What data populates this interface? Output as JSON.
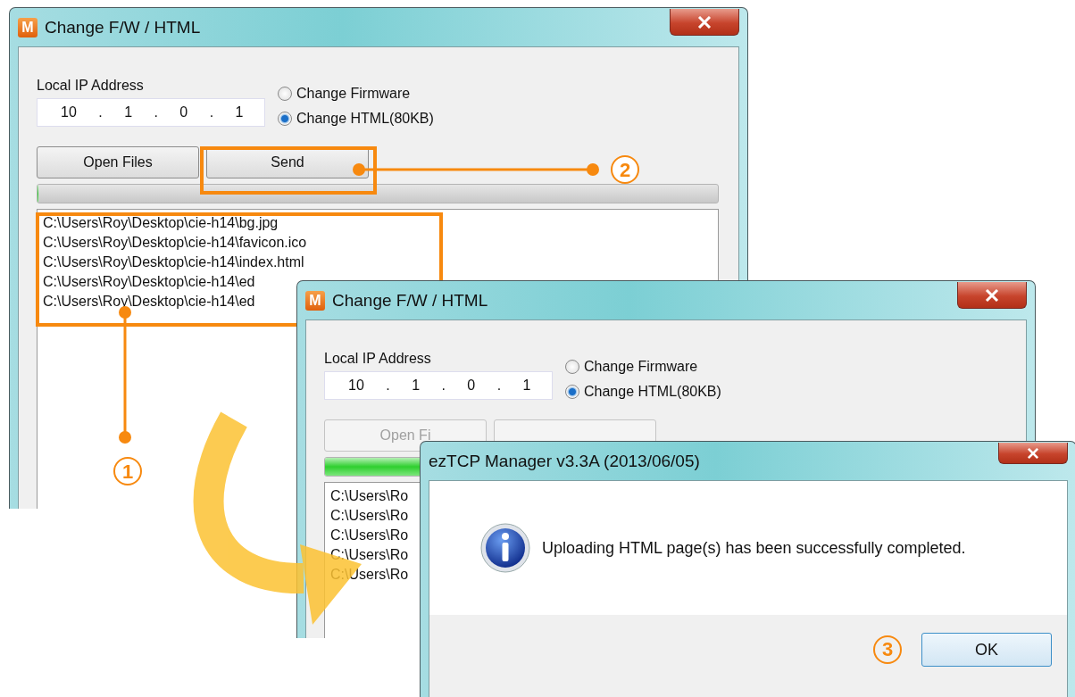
{
  "windows": [
    {
      "title": "Change F/W / HTML",
      "icon_letter": "M",
      "ip_label": "Local IP Address",
      "ip": "10 . 1 . 0 . 1",
      "options": [
        {
          "label": "Change Firmware",
          "selected": false
        },
        {
          "label": "Change HTML(80KB)",
          "selected": true
        }
      ],
      "buttons": [
        {
          "label": "Open Files",
          "disabled": false
        },
        {
          "label": "Send",
          "disabled": false
        }
      ],
      "progress": {
        "level": 0
      },
      "files": [
        "C:\\Users\\Roy\\Desktop\\cie-h14\\bg.jpg",
        "C:\\Users\\Roy\\Desktop\\cie-h14\\favicon.ico",
        "C:\\Users\\Roy\\Desktop\\cie-h14\\index.html",
        "C:\\Users\\Roy\\Desktop\\cie-h14\\ed",
        "C:\\Users\\Roy\\Desktop\\cie-h14\\ed"
      ]
    },
    {
      "title": "Change F/W / HTML",
      "icon_letter": "M",
      "ip_label": "Local IP Address",
      "ip": "10 . 1 . 0 . 1",
      "options": [
        {
          "label": "Change Firmware",
          "selected": false
        },
        {
          "label": "Change HTML(80KB)",
          "selected": true
        }
      ],
      "buttons": [
        {
          "label": "Open Fi",
          "disabled": true
        },
        {
          "disabled": true
        }
      ],
      "progress": {
        "level": 1
      },
      "files": [
        "C:\\Users\\Ro",
        "C:\\Users\\Ro",
        "C:\\Users\\Ro",
        "C:\\Users\\Ro",
        "C:\\Users\\Ro"
      ]
    }
  ],
  "dialog": {
    "title": "ezTCP Manager v3.3A (2013/06/05)",
    "message": "Uploading HTML page(s) has been successfully completed.",
    "button": "OK"
  },
  "callouts": [
    {
      "number": "1"
    },
    {
      "number": "2"
    },
    {
      "number": "3"
    }
  ]
}
